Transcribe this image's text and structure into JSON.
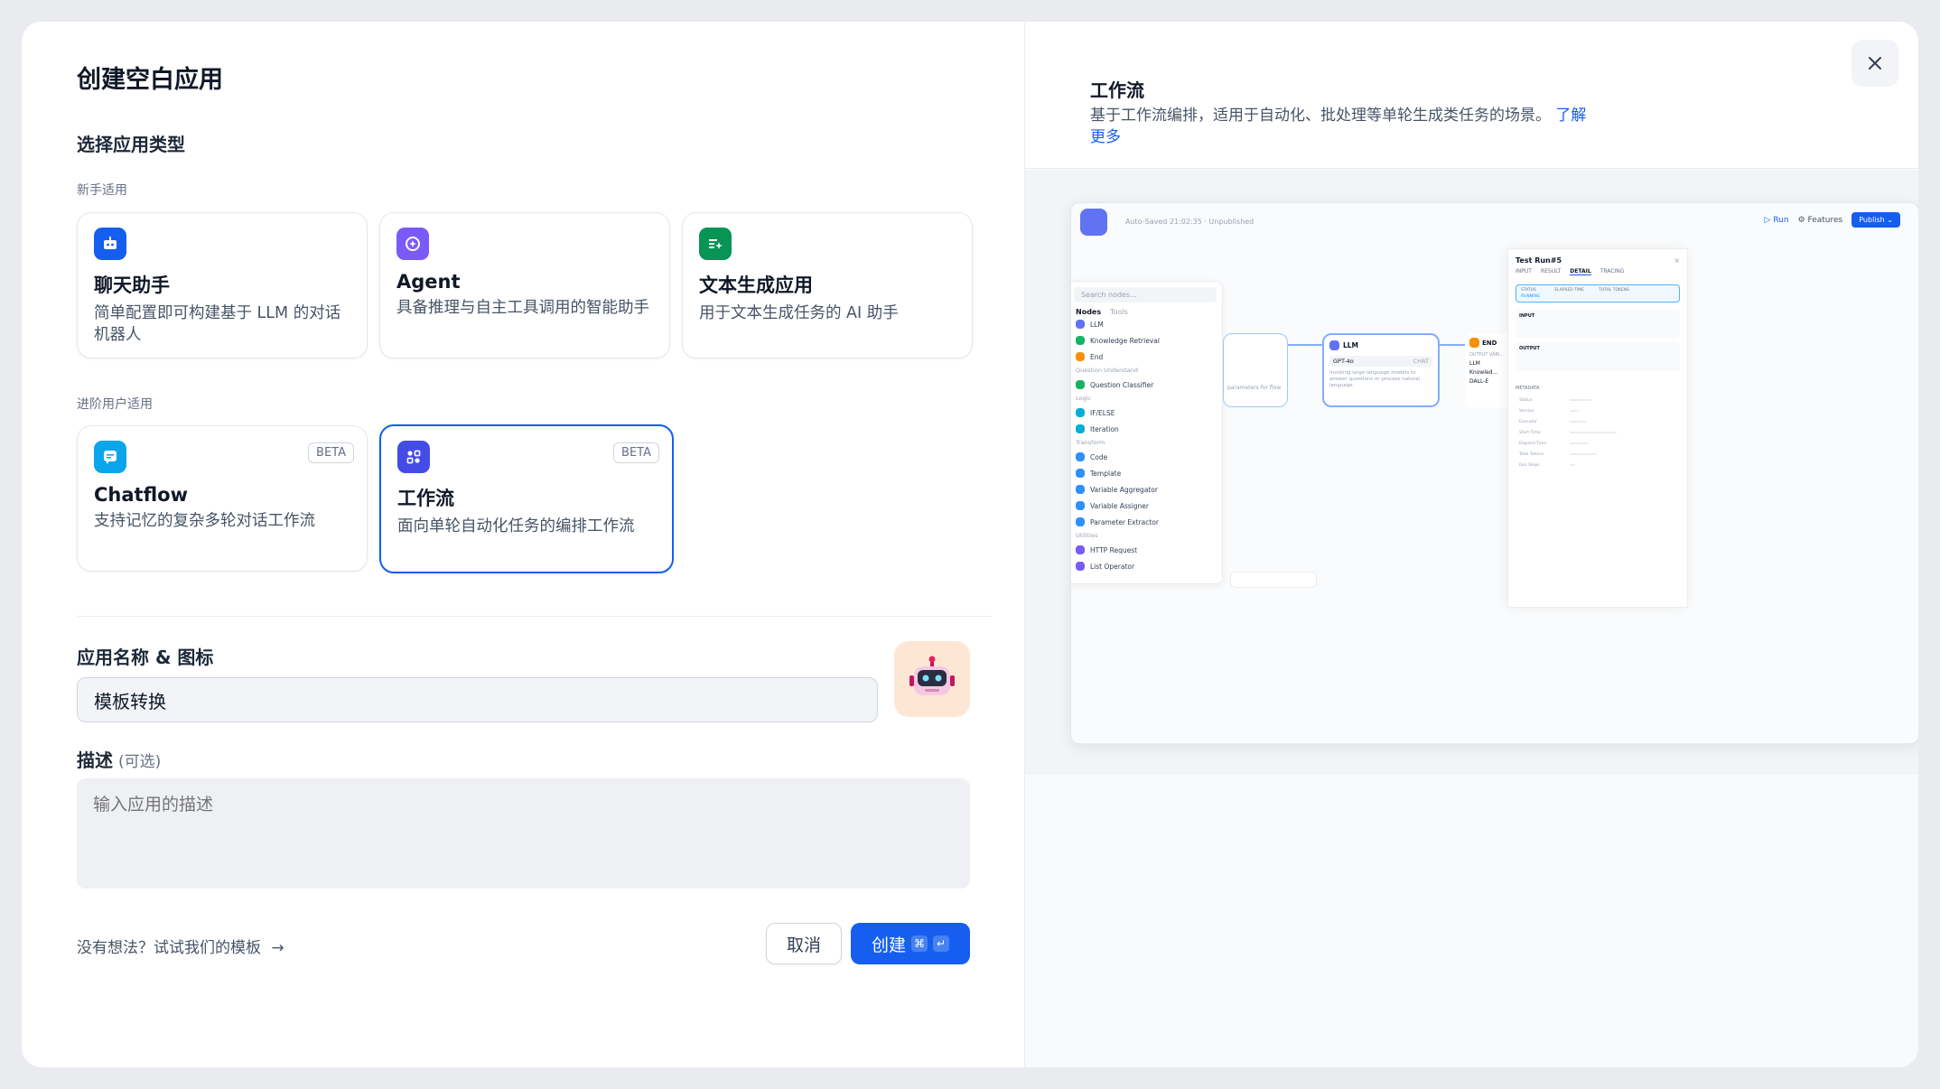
{
  "modal": {
    "title": "创建空白应用",
    "section_title": "选择应用类型",
    "beginner_label": "新手适用",
    "advanced_label": "进阶用户适用",
    "app_types": [
      {
        "name": "聊天助手",
        "desc": "简单配置即可构建基于 LLM 的对话机器人",
        "icon": "chat-bot-icon",
        "color": "#155eef"
      },
      {
        "name": "Agent",
        "desc": "具备推理与自主工具调用的智能助手",
        "icon": "agent-icon",
        "color": "#7a5af8"
      },
      {
        "name": "文本生成应用",
        "desc": "用于文本生成任务的 AI 助手",
        "icon": "text-generation-icon",
        "color": "#079455"
      },
      {
        "name": "Chatflow",
        "desc": "支持记忆的复杂多轮对话工作流",
        "icon": "chatflow-icon",
        "color": "#0ba5ec",
        "badge": "BETA"
      },
      {
        "name": "工作流",
        "desc": "面向单轮自动化任务的编排工作流",
        "icon": "workflow-icon",
        "color": "#444ce7",
        "badge": "BETA",
        "selected": true
      }
    ],
    "name_label": "应用名称 & 图标",
    "name_value": "模板转换",
    "desc_label": "描述",
    "desc_optional": "(可选)",
    "desc_placeholder": "输入应用的描述",
    "template_link": "没有想法？试试我们的模板",
    "cancel_label": "取消",
    "create_label": "创建",
    "create_shortcut": [
      "⌘",
      "↵"
    ]
  },
  "preview": {
    "title": "工作流",
    "desc": "基于工作流编排，适用于自动化、批处理等单轮生成类任务的场景。",
    "learn_more": "了解更多",
    "canvas": {
      "autosave": "Auto-Saved 21:02:35 · Unpublished",
      "run": "Run",
      "features": "Features",
      "publish": "Publish",
      "search_placeholder": "Search nodes...",
      "tabs": [
        "Nodes",
        "Tools"
      ],
      "groups": [
        {
          "name": "",
          "items": [
            "LLM",
            "Knowledge Retrieval",
            "End"
          ]
        },
        {
          "name": "Question Understand",
          "items": [
            "Question Classifier"
          ]
        },
        {
          "name": "Logic",
          "items": [
            "IF/ELSE",
            "Iteration"
          ]
        },
        {
          "name": "Transform",
          "items": [
            "Code",
            "Template",
            "Variable Aggregator",
            "Variable Assigner",
            "Parameter Extractor"
          ]
        },
        {
          "name": "Utilities",
          "items": [
            "HTTP Request",
            "List Operator"
          ]
        }
      ],
      "llm_node": {
        "title": "LLM",
        "model": "GPT-4o",
        "mode": "CHAT",
        "desc": "Invoking large language models to answer questions or process natural language"
      },
      "side_node_text": "parameters for flow",
      "end_node": {
        "title": "END",
        "vars_label": "OUTPUT VARI...",
        "vars": [
          "LLM",
          "Knowled...",
          "DALL-E"
        ]
      },
      "test_run": {
        "title": "Test Run#5",
        "tabs": [
          "INPUT",
          "RESULT",
          "DETAIL",
          "TRACING"
        ],
        "active_tab": "DETAIL",
        "status_label": "STATUS",
        "status": "RUNNING",
        "elapsed_label": "ELAPSED TIME",
        "tokens_label": "TOTAL TOKENS",
        "input_label": "INPUT",
        "output_label": "OUTPUT",
        "metadata_label": "METADATA",
        "metadata_rows": [
          "Status",
          "Version",
          "Executor",
          "Start Time",
          "Elapsed Time",
          "Total Tokens",
          "Run Steps"
        ]
      }
    }
  }
}
